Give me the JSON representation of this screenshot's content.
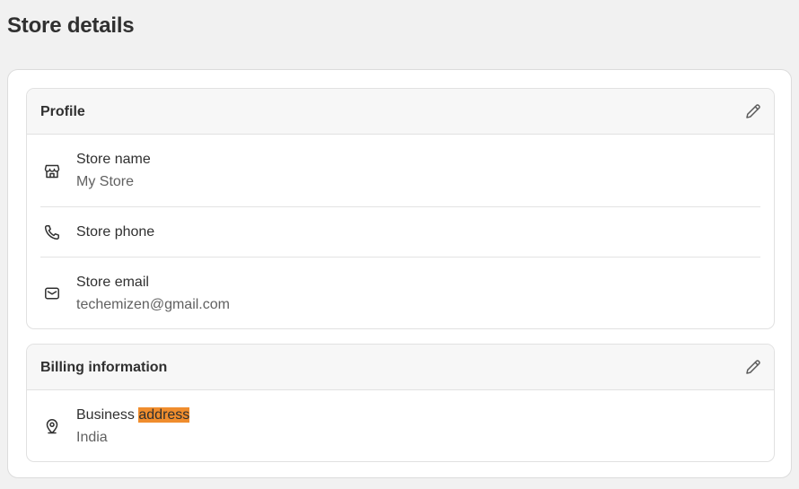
{
  "page": {
    "title": "Store details"
  },
  "profile": {
    "title": "Profile",
    "edit_icon": "pencil-icon",
    "rows": [
      {
        "icon": "store-icon",
        "label": "Store name",
        "value": "My Store"
      },
      {
        "icon": "phone-icon",
        "label": "Store phone",
        "value": ""
      },
      {
        "icon": "email-icon",
        "label": "Store email",
        "value": "techemizen@gmail.com"
      }
    ]
  },
  "billing": {
    "title": "Billing information",
    "edit_icon": "pencil-icon",
    "rows": [
      {
        "icon": "location-pin-icon",
        "label_prefix": "Business ",
        "label_highlight": "address",
        "value": "India"
      }
    ]
  },
  "colors": {
    "page_bg": "#f1f1f1",
    "card_bg": "#ffffff",
    "header_bg": "#f7f7f7",
    "text_primary": "#303030",
    "text_secondary": "#616161",
    "search_highlight": "#f08d2d"
  }
}
